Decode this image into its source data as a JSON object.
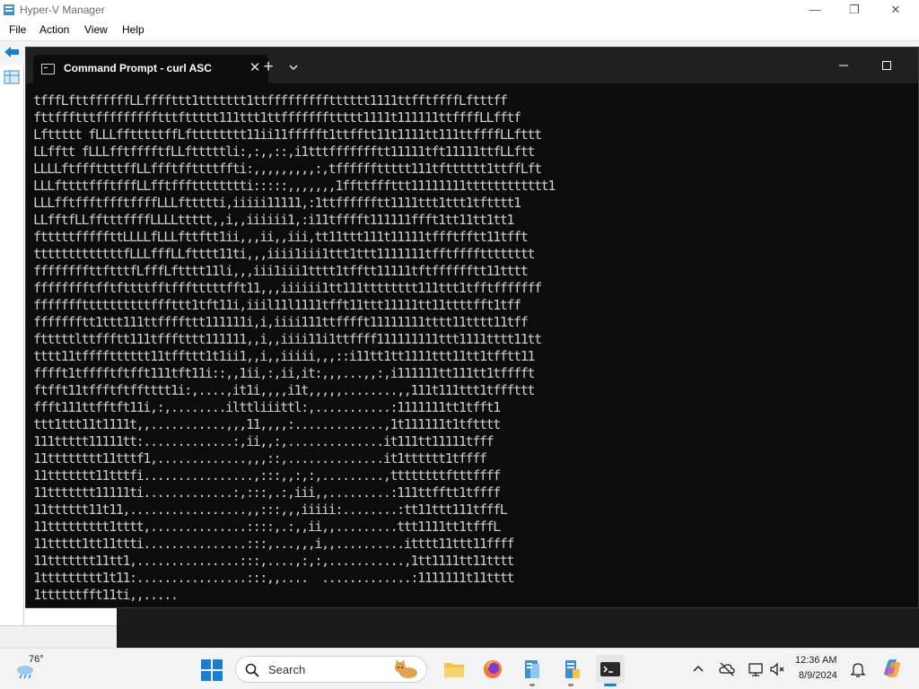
{
  "hyperv": {
    "title": "Hyper-V Manager",
    "menu": [
      "File",
      "Action",
      "View",
      "Help"
    ],
    "window_buttons": {
      "minimize": "—",
      "restore": "❐",
      "close": "✕"
    }
  },
  "terminal": {
    "tab_title": "Command Prompt - curl  ASC",
    "close_glyph": "✕",
    "new_tab_glyph": "+",
    "output_lines": [
      "tfffLfttffffffLLffffttt1ttttttt1ttffffffffftttttt1111ttfftffffLftttff",
      "fttffftttffffffffftttfttttt111ttt1ttfffffffttttt1111t111111ttffffLLfftf",
      "Lfttttt fLLLfftttttffLftttttttt11ii11ffffft1ttfftt11t1111tt111ttffffLLfttt",
      "LLfftt fLLLfftfffftfLLftttttli:,:,,::,i1tttffffffftt11111tft11111ttfLLftt",
      "LLLLftfffttttffLLffftffttttffti:,,,,,,,,,:,tffffffttttt111tftttttt1ttffLft",
      "LLLfttttffftfffLLfftffftttttttti:::::,,,,,,,1ffttfffttt11111111tttttttttttt1",
      "LLLfftffftffftffffLLLfttttti,iiiii11111,:1ttfffffftt1111ttt1ttt1tftttt1",
      "LLfftfLLfftttffffLLLLttttt,,i,,iiiiii1,:i11tfffft111111ffft1tt11tt1tt1",
      "ftttttfffffttLLLLfLLLfttftt1ii,,,ii,,iii,tt11ttt111t11111tffftfftt11tfft",
      "tttttttttttttfLLLfffLLftttt11ti,,,iiii1iii1ttt1ttt1111111tfftfffftttttttt",
      "ffffffffttftttfLfffLftttt11li,,,iii1iii1tttt1tfftt11111tftfffffftt11tttt",
      "fffffffftfftfttttfftffftttttfft11,,,iiiiii1tt111tttttttt111ttt1tfftfffffff",
      "fffffffttttttttttfffttt1tft11i,iiil11l1111tfft11ttt11111tt11ttttfft1tff",
      "ffffffftt1ttt111ttffffttt111111i,i,iiii111ttfffft11111111tttt11tttt11tff",
      "ftttttlttffftt111tffftttt111111,,i,,iiii11i1ttffff111111111ttt1111tttt11tt",
      "tttt11tfffftttttt11tffttt1t1ii1,,i,,iiiii,,,::i11tt1tt1111ttt11tt1tfftt11",
      "fffft1tfffftftfft111tft11i::,,1ii,:,ii,it:,,,...,,:,i111111tt111tt1tfffft",
      "ftfft11tffftftfftttt1i:,....,it1i,,,,i1t,,,,,........,,111t111ttt1tfffttt",
      "ffft111ttfftft11i,:,........ilttliiittl:,...........:1111111tt1tfft1",
      "ttt1ttt11t1111t,,...........,,,11,,,,:.............,1t111111t1tftttt",
      "111ttttt11111tt:.............:,ii,,:,..............it111tt11111tfff",
      "11tttttttt11tttf1,.............,,,::,..............it1tttttt1tffff",
      "11ttttttt11tttfi................,:::,,:,:,.........,ttttttttftttffff",
      "11ttttttt11111ti.............:,:::,.:,iii,,.........:111ttfftt1tffff",
      "11tttttt11t11,.................,,:::,,,iiiii:........:tt11ttt111tfffL",
      "11ttttttttt1tttt,..............::::,.:,,ii,,.........ttt1111tt1tfffL",
      "11ttttt1tt11ttti...............:::,...,,,i,,..........itttt11ttt11ffff",
      "11ttttttt11tt1,...............:::,....,:,:,...........,1tt1111tt11tttt",
      "1ttttttttt1t11:................:::,,....  .............:1111111t11tttt",
      "1ttttttfft11ti,,....."
    ]
  },
  "taskbar": {
    "weather_temp": "76°",
    "search_label": "Search",
    "clock_time": "12:36 AM",
    "clock_date": "8/9/2024"
  },
  "colors": {
    "terminal_bg": "#0c0c0c",
    "terminal_text": "#cccccc",
    "tabbar_bg": "#202020",
    "taskbar_bg": "#f3f3f3",
    "accent": "#1a7fd4"
  }
}
